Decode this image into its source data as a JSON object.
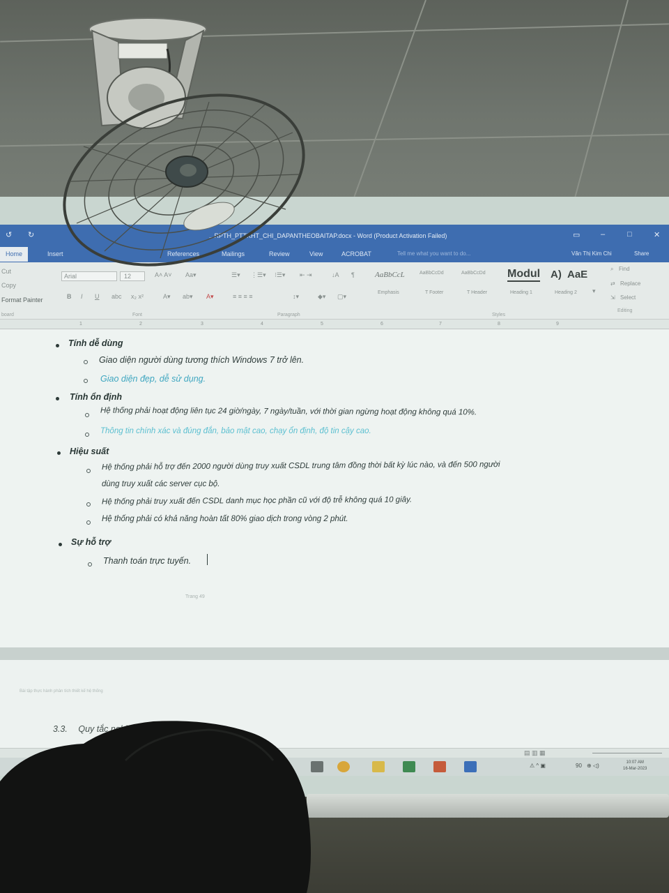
{
  "window": {
    "title": "...RPTH_PTTKHT_CHI_DAPANTHEOBAITAP.docx - Word (Product Activation Failed)",
    "user_name": "Văn Thị Kim Chi",
    "share_label": "Share"
  },
  "tabs": [
    "Home",
    "Insert",
    "References",
    "Mailings",
    "Review",
    "View",
    "ACROBAT"
  ],
  "tell_me": "Tell me what you want to do...",
  "ribbon": {
    "clipboard": {
      "cut": "Cut",
      "copy": "Copy",
      "format_painter": "Format Painter",
      "label": "board"
    },
    "font": {
      "name": "Arial",
      "size": "12",
      "label": "Font"
    },
    "paragraph": {
      "label": "Paragraph"
    },
    "styles": {
      "items": [
        {
          "preview": "AaBbCcL",
          "name": "Emphasis"
        },
        {
          "preview": "AaBbCcDd",
          "name": "T Footer"
        },
        {
          "preview": "AaBbCcDd",
          "name": "T Header"
        },
        {
          "preview": "Modul",
          "name": "Heading 1"
        },
        {
          "preview": "A)",
          "name": ""
        },
        {
          "preview": "AaE",
          "name": "Heading 2"
        }
      ],
      "label": "Styles"
    },
    "editing": {
      "find": "Find",
      "replace": "Replace",
      "select": "Select",
      "label": "Editing"
    }
  },
  "ruler_ticks": [
    "1",
    "2",
    "3",
    "4",
    "5",
    "6",
    "7",
    "8",
    "9"
  ],
  "document": {
    "sections": [
      {
        "heading": "Tính dễ dùng",
        "items": [
          {
            "text": "Giao diện người dùng tương thích Windows 7 trở lên.",
            "style": "normal"
          },
          {
            "text": "Giao diện đẹp, dễ sử dụng.",
            "style": "blue"
          }
        ]
      },
      {
        "heading": "Tính ổn định",
        "items": [
          {
            "text": "Hệ thống phải hoạt động liên tục 24 giờ/ngày, 7 ngày/tuần, với thời gian ngừng hoạt động không quá 10%.",
            "style": "normal"
          },
          {
            "text": "Thông tin chính xác và đúng đắn, bảo mật cao, chạy ổn định, độ tin cậy cao.",
            "style": "faint-blue"
          }
        ]
      },
      {
        "heading": "Hiệu suất",
        "items": [
          {
            "text": "Hệ thống phải hỗ trợ đến 2000 người dùng truy xuất CSDL trung tâm đồng thời bất kỳ lúc nào, và đến 500 người",
            "continuation": "dùng truy xuất các server cục bộ.",
            "style": "normal"
          },
          {
            "text": "Hệ thống phải truy xuất đến CSDL danh mục học phần cũ với độ trễ không quá 10 giây.",
            "style": "normal"
          },
          {
            "text": "Hệ thống phải có khả năng hoàn tất 80% giao dịch trong vòng 2 phút.",
            "style": "normal"
          }
        ]
      },
      {
        "heading": "Sự hỗ trợ",
        "items": [
          {
            "text": "Thanh toán trực tuyến.",
            "style": "normal"
          }
        ]
      }
    ],
    "page_number": "Trang 49",
    "footer_note": "Bài tập thực hành phân tích thiết kế hệ thống",
    "next_heading": {
      "number": "3.3.",
      "text": "Quy tắc nghi"
    }
  },
  "taskbar": {
    "time": "10:07 AM",
    "date": "16-Mar-2023",
    "tray_number": "90"
  },
  "colors": {
    "title_bar": "#3e6db0",
    "screen_bg": "#e3ece8",
    "text": "#2f3d3b",
    "link_blue": "#3ea6c0"
  }
}
